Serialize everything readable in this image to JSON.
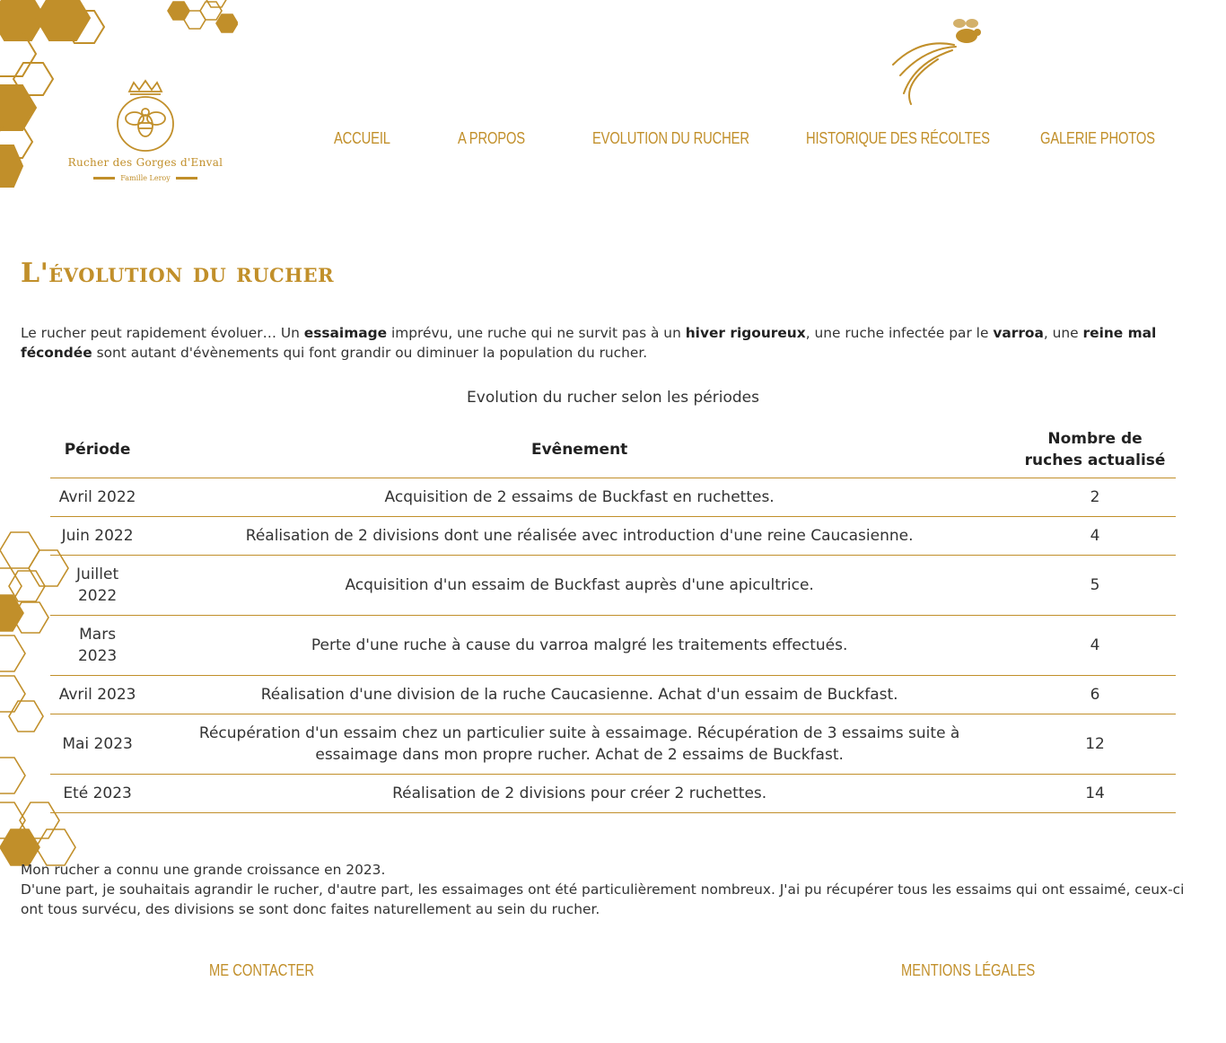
{
  "site": {
    "logo_title": "Rucher des Gorges d'Enval",
    "logo_subtitle": "Famille Leroy"
  },
  "nav": {
    "items": [
      {
        "label": "ACCUEIL"
      },
      {
        "label": "A PROPOS"
      },
      {
        "label": "EVOLUTION DU RUCHER"
      },
      {
        "label": "HISTORIQUE DES RÉCOLTES"
      },
      {
        "label": "GALERIE PHOTOS"
      }
    ]
  },
  "page": {
    "title": "L'évolution du rucher",
    "intro": {
      "t1": "Le rucher peut rapidement évoluer… Un ",
      "b1": "essaimage",
      "t2": " imprévu, une ruche qui ne survit pas à un ",
      "b2": "hiver rigoureux",
      "t3": ", une ruche infectée par le ",
      "b3": "varroa",
      "t4": ", une ",
      "b4": "reine mal fécondée",
      "t5": " sont autant d'évènements qui font grandir ou diminuer la population du rucher."
    },
    "table_caption": "Evolution du rucher selon les périodes",
    "table": {
      "headers": [
        "Période",
        "Evênement",
        "Nombre de ruches actualisé"
      ],
      "rows": [
        [
          "Avril 2022",
          "Acquisition de 2 essaims de Buckfast en ruchettes.",
          "2"
        ],
        [
          "Juin 2022",
          "Réalisation de 2 divisions dont une réalisée avec introduction d'une reine Caucasienne.",
          "4"
        ],
        [
          "Juillet 2022",
          "Acquisition d'un essaim de Buckfast auprès d'une apicultrice.",
          "5"
        ],
        [
          "Mars 2023",
          "Perte d'une ruche à cause du varroa malgré les traitements effectués.",
          "4"
        ],
        [
          "Avril 2023",
          "Réalisation d'une division de la ruche Caucasienne. Achat d'un essaim de Buckfast.",
          "6"
        ],
        [
          "Mai 2023",
          "Récupération d'un essaim chez un particulier suite à essaimage. Récupération de 3 essaims suite à essaimage dans mon propre rucher. Achat de 2 essaims de Buckfast.",
          "12"
        ],
        [
          "Eté 2023",
          "Réalisation de 2 divisions pour créer 2 ruchettes.",
          "14"
        ]
      ]
    },
    "outro": {
      "line1": "Mon rucher a connu une grande croissance en 2023.",
      "line2": "D'une part, je souhaitais agrandir le rucher, d'autre part, les essaimages ont été particulièrement nombreux. J'ai pu récupérer tous les essaims qui ont essaimé, ceux-ci ont tous survécu, des divisions se sont donc faites naturellement au sein du rucher."
    }
  },
  "footer": {
    "contact": "ME CONTACTER",
    "legal": "MENTIONS LÉGALES"
  },
  "theme": {
    "accent": "#C18F2A",
    "text": "#333333",
    "background": "#FFFFFF"
  }
}
